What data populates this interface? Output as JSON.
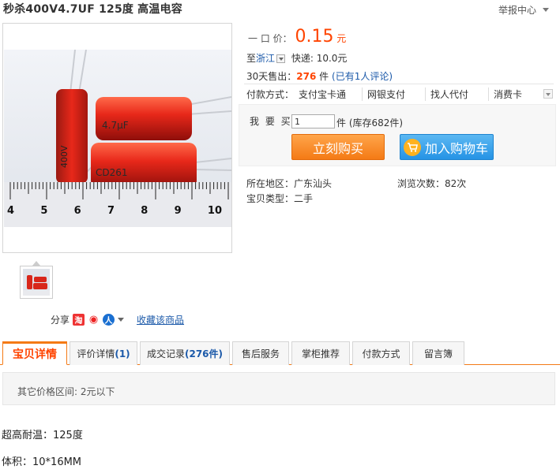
{
  "title": "秒杀400V4.7UF 125度 高温电容",
  "report": "举报中心",
  "price": {
    "label": "一 口 价：",
    "value": "0.15",
    "unit": "元"
  },
  "shipping": {
    "to": "至",
    "region": "浙江",
    "express": "快递: 10.0元"
  },
  "sales": {
    "label": "30天售出：",
    "count": "276",
    "unit": "件",
    "reviews": "(已有1人评论)"
  },
  "payment": {
    "label": "付款方式：",
    "methods": [
      "支付宝卡通",
      "网银支付",
      "找人代付",
      "消费卡"
    ]
  },
  "buy": {
    "qty_label": "我 要 买：",
    "qty_value": "1",
    "stock": "件 (库存682件)",
    "buy_now": "立刻购买",
    "add_cart": "加入购物车"
  },
  "details": {
    "location_label": "所在地区：",
    "location": "广东汕头",
    "views_label": "浏览次数：",
    "views": "82次",
    "type_label": "宝贝类型：",
    "type": "二手"
  },
  "share": {
    "label": "分享",
    "favorite": "收藏该商品"
  },
  "tabs": [
    {
      "label": "宝贝详情"
    },
    {
      "label": "评价详情",
      "count": "(1)"
    },
    {
      "label": "成交记录",
      "count": "(276件)"
    },
    {
      "label": "售后服务"
    },
    {
      "label": "掌柜推荐"
    },
    {
      "label": "付款方式"
    },
    {
      "label": "留言簿"
    }
  ],
  "price_range": "其它价格区间: 2元以下",
  "description": [
    "超高耐温：125度",
    "体积：10*16MM"
  ],
  "photo_text": {
    "cap_value": "4.7μF",
    "cap_model": "CD261",
    "ruler_numbers": [
      "4",
      "5",
      "6",
      "7",
      "8",
      "9",
      "10"
    ]
  },
  "colors": {
    "accent": "#ff4400",
    "buy_button": "#f47a15",
    "cart_button": "#2593e5",
    "link": "#1b59a9"
  }
}
